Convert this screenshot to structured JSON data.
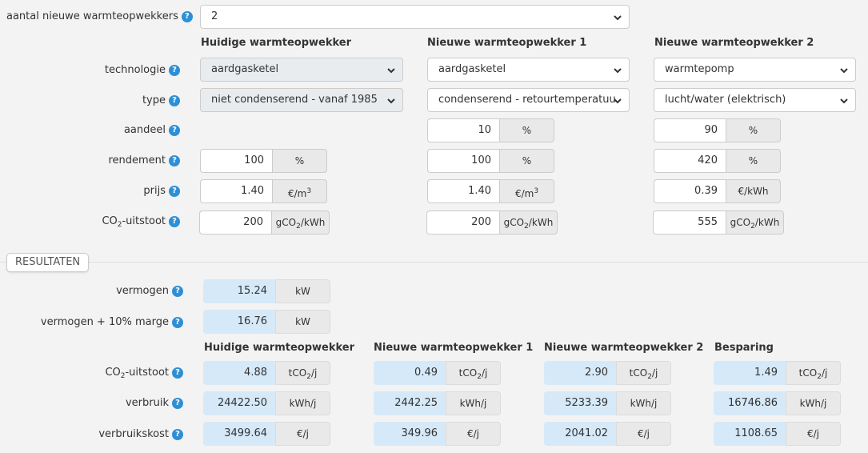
{
  "top": {
    "label": "aantal nieuwe warmteopwekkers",
    "value": "2"
  },
  "columns": {
    "current": "Huidige warmteopwekker",
    "new1": "Nieuwe warmteopwekker 1",
    "new2": "Nieuwe warmteopwekker 2"
  },
  "labels": {
    "technologie": "technologie",
    "type": "type",
    "aandeel": "aandeel",
    "rendement": "rendement",
    "prijs": "prijs",
    "co2_pre": "CO",
    "co2_sub": "2",
    "co2_post": "-uitstoot"
  },
  "inputs": {
    "current": {
      "technologie": "aardgasketel",
      "type": "niet condenserend - vanaf 1985",
      "rendement": "100",
      "rendement_unit": "%",
      "prijs": "1.40",
      "prijs_unit_pre": "€/m",
      "prijs_unit_sup": "3",
      "co2": "200",
      "co2_unit_pre": "gCO",
      "co2_unit_sub": "2",
      "co2_unit_post": "/kWh"
    },
    "new1": {
      "technologie": "aardgasketel",
      "type": "condenserend - retourtemperatuu",
      "aandeel": "10",
      "aandeel_unit": "%",
      "rendement": "100",
      "rendement_unit": "%",
      "prijs": "1.40",
      "prijs_unit_pre": "€/m",
      "prijs_unit_sup": "3",
      "co2": "200",
      "co2_unit_pre": "gCO",
      "co2_unit_sub": "2",
      "co2_unit_post": "/kWh"
    },
    "new2": {
      "technologie": "warmtepomp",
      "type": "lucht/water (elektrisch)",
      "aandeel": "90",
      "aandeel_unit": "%",
      "rendement": "420",
      "rendement_unit": "%",
      "prijs": "0.39",
      "prijs_unit": "€/kWh",
      "co2": "555",
      "co2_unit_pre": "gCO",
      "co2_unit_sub": "2",
      "co2_unit_post": "/kWh"
    }
  },
  "results": {
    "section_label": "RESULTATEN",
    "vermogen_label": "vermogen",
    "vermogen": "15.24",
    "vermogen_unit": "kW",
    "marge_label": "vermogen + 10% marge",
    "marge": "16.76",
    "marge_unit": "kW",
    "col_current": "Huidige warmteopwekker",
    "col_new1": "Nieuwe warmteopwekker 1",
    "col_new2": "Nieuwe warmteopwekker 2",
    "col_saving": "Besparing",
    "co2_label_pre": "CO",
    "co2_label_sub": "2",
    "co2_label_post": "-uitstoot",
    "verbruik_label": "verbruik",
    "kost_label": "verbruikskost",
    "co2_unit_pre": "tCO",
    "co2_unit_sub": "2",
    "co2_unit_post": "/j",
    "verbruik_unit": "kWh/j",
    "kost_unit": "€/j",
    "current": {
      "co2": "4.88",
      "verbruik": "24422.50",
      "kost": "3499.64"
    },
    "new1": {
      "co2": "0.49",
      "verbruik": "2442.25",
      "kost": "349.96"
    },
    "new2": {
      "co2": "2.90",
      "verbruik": "5233.39",
      "kost": "2041.02"
    },
    "saving": {
      "co2": "1.49",
      "verbruik": "16746.86",
      "kost": "1108.65"
    }
  },
  "icons": {
    "help": "question-circle-icon",
    "select": "chevron-down-icon"
  },
  "colors": {
    "help": "#2d8fd5",
    "result_bg": "#d6e9f8",
    "unit_bg": "#e9e9e9",
    "page_bg": "#f3f3f3"
  }
}
